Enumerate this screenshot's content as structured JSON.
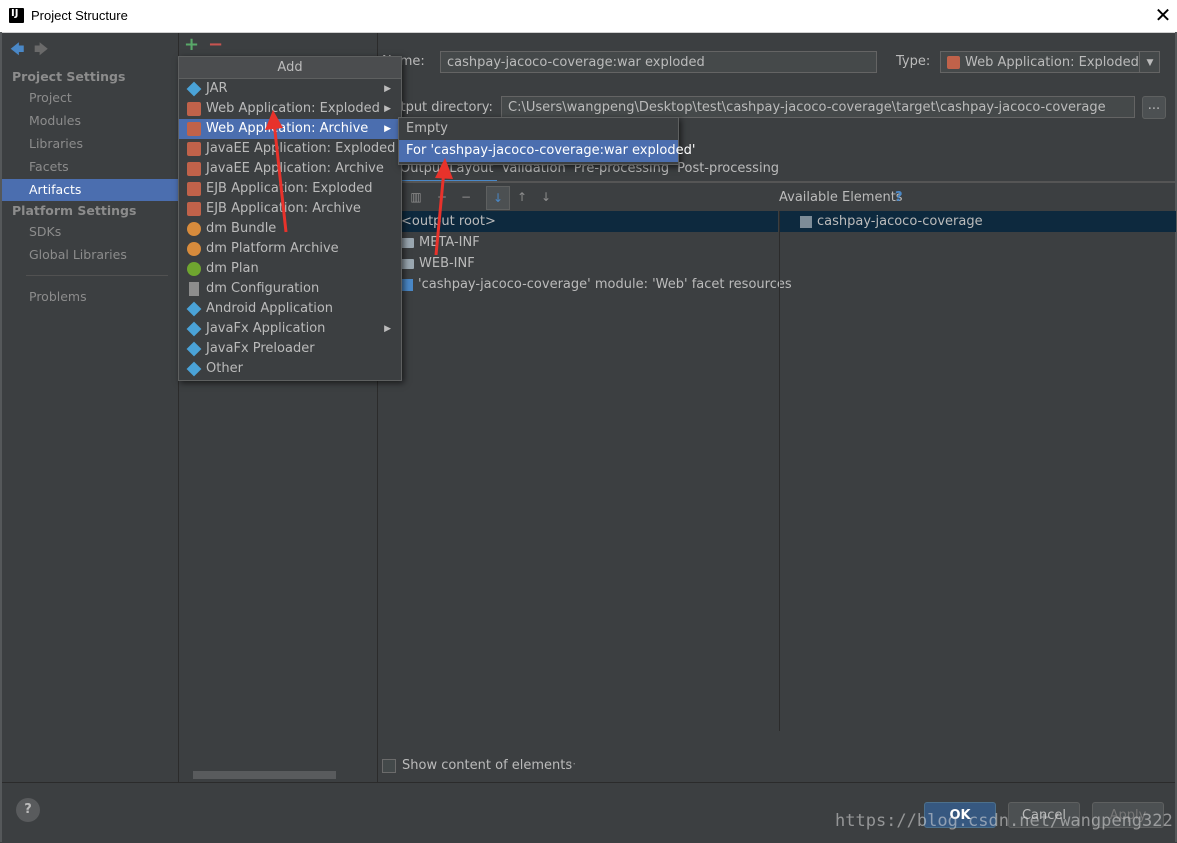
{
  "window": {
    "title": "Project Structure",
    "close_label": "✕"
  },
  "nav": {
    "back": "🡄",
    "forward": "🡆"
  },
  "sidebar": {
    "project_settings_header": "Project Settings",
    "project_items": [
      "Project",
      "Modules",
      "Libraries",
      "Facets",
      "Artifacts"
    ],
    "platform_settings_header": "Platform Settings",
    "platform_items": [
      "SDKs",
      "Global Libraries"
    ],
    "problems": "Problems",
    "selected": "Artifacts"
  },
  "artifact_toolbar": {
    "add": "+",
    "remove": "−"
  },
  "form": {
    "name_label": "Name:",
    "name_value": "cashpay-jacoco-coverage:war exploded",
    "type_label": "Type:",
    "type_value": "Web Application: Exploded",
    "output_label": "Output directory:",
    "output_value": "C:\\Users\\wangpeng\\Desktop\\test\\cashpay-jacoco-coverage\\target\\cashpay-jacoco-coverage",
    "browse": "..."
  },
  "tabs": [
    "Output Layout",
    "Validation",
    "Pre-processing",
    "Post-processing"
  ],
  "available_elements_label": "Available Elements",
  "available_help": "?",
  "layout_tree": [
    "<output root>",
    "META-INF",
    "WEB-INF",
    "'cashpay-jacoco-coverage' module: 'Web' facet resources"
  ],
  "available_tree": [
    "cashpay-jacoco-coverage"
  ],
  "show_content_label": "Show content of elements",
  "add_menu": {
    "header": "Add",
    "items": [
      {
        "label": "JAR",
        "icon": "diamond-icon",
        "submenu": true
      },
      {
        "label": "Web Application: Exploded",
        "icon": "javaee-icon",
        "submenu": true
      },
      {
        "label": "Web Application: Archive",
        "icon": "javaee-icon",
        "submenu": true
      },
      {
        "label": "JavaEE Application: Exploded",
        "icon": "javaee-icon",
        "submenu": false
      },
      {
        "label": "JavaEE Application: Archive",
        "icon": "javaee-icon",
        "submenu": false
      },
      {
        "label": "EJB Application: Exploded",
        "icon": "javaee-icon",
        "submenu": false
      },
      {
        "label": "EJB Application: Archive",
        "icon": "javaee-icon",
        "submenu": false
      },
      {
        "label": "dm Bundle",
        "icon": "osgi-icon",
        "submenu": false
      },
      {
        "label": "dm Platform Archive",
        "icon": "osgi-icon",
        "submenu": false
      },
      {
        "label": "dm Plan",
        "icon": "plan-icon",
        "submenu": false
      },
      {
        "label": "dm Configuration",
        "icon": "document-icon",
        "submenu": false
      },
      {
        "label": "Android Application",
        "icon": "diamond-icon",
        "submenu": false
      },
      {
        "label": "JavaFx Application",
        "icon": "diamond-icon",
        "submenu": true
      },
      {
        "label": "JavaFx Preloader",
        "icon": "diamond-icon",
        "submenu": false
      },
      {
        "label": "Other",
        "icon": "diamond-icon",
        "submenu": false
      }
    ],
    "highlighted": "Web Application: Archive"
  },
  "submenu": {
    "items": [
      "Empty",
      "For 'cashpay-jacoco-coverage:war exploded'"
    ],
    "highlighted": "For 'cashpay-jacoco-coverage:war exploded'"
  },
  "buttons": {
    "ok": "OK",
    "cancel": "Cancel",
    "apply": "Apply",
    "help": "?"
  },
  "watermark": "https://blog.csdn.net/wangpeng322",
  "colors": {
    "selection": "#4b6eaf",
    "annotation_arrow": "#e8322b"
  }
}
